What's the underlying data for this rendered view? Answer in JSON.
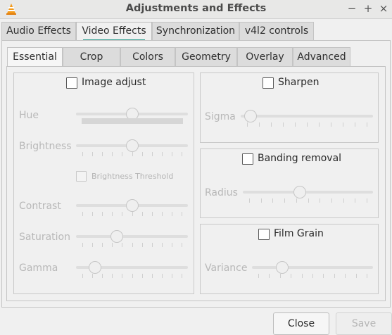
{
  "window": {
    "title": "Adjustments and Effects",
    "controls": {
      "minimize": "−",
      "maximize": "+",
      "close": "×"
    }
  },
  "top_tabs": [
    {
      "label": "Audio Effects",
      "active": false
    },
    {
      "label": "Video Effects",
      "active": true
    },
    {
      "label": "Synchronization",
      "active": false
    },
    {
      "label": "v4l2 controls",
      "active": false
    }
  ],
  "inner_tabs": [
    {
      "label": "Essential",
      "active": true
    },
    {
      "label": "Crop",
      "active": false
    },
    {
      "label": "Colors",
      "active": false
    },
    {
      "label": "Geometry",
      "active": false
    },
    {
      "label": "Overlay",
      "active": false
    },
    {
      "label": "Advanced",
      "active": false
    }
  ],
  "image_adjust": {
    "label": "Image adjust",
    "checked": false,
    "hue": {
      "label": "Hue",
      "value": 0.5
    },
    "brightness": {
      "label": "Brightness",
      "value": 0.5
    },
    "brightness_threshold": {
      "label": "Brightness Threshold",
      "checked": false
    },
    "contrast": {
      "label": "Contrast",
      "value": 0.5
    },
    "saturation": {
      "label": "Saturation",
      "value": 0.35
    },
    "gamma": {
      "label": "Gamma",
      "value": 0.13
    }
  },
  "sharpen": {
    "label": "Sharpen",
    "checked": false,
    "sigma": {
      "label": "Sigma",
      "value": 0.03
    }
  },
  "banding_removal": {
    "label": "Banding removal",
    "checked": false,
    "radius": {
      "label": "Radius",
      "value": 0.43
    }
  },
  "film_grain": {
    "label": "Film Grain",
    "checked": false,
    "variance": {
      "label": "Variance",
      "value": 0.22
    }
  },
  "buttons": {
    "close": "Close",
    "save": "Save"
  },
  "colors": {
    "accent_tab_underline": "#2a9d8f"
  }
}
